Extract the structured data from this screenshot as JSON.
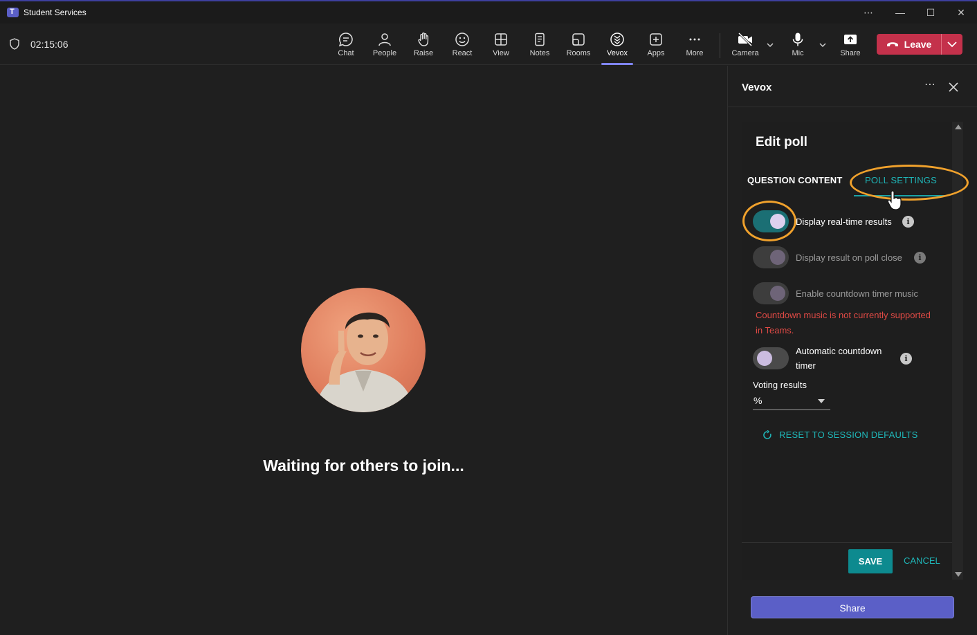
{
  "window": {
    "title": "Student Services",
    "controls": [
      "...",
      "—",
      "☐",
      "✕"
    ]
  },
  "toolbar": {
    "timer": "02:15:06",
    "buttons": [
      {
        "label": "Chat",
        "icon": "chat-icon"
      },
      {
        "label": "People",
        "icon": "people-icon"
      },
      {
        "label": "Raise",
        "icon": "raise-hand-icon"
      },
      {
        "label": "React",
        "icon": "smiley-icon"
      },
      {
        "label": "View",
        "icon": "grid-view-icon"
      },
      {
        "label": "Notes",
        "icon": "notes-icon"
      },
      {
        "label": "Rooms",
        "icon": "rooms-icon"
      },
      {
        "label": "Vevox",
        "icon": "vevox-icon",
        "active": true
      },
      {
        "label": "Apps",
        "icon": "apps-plus-icon"
      },
      {
        "label": "More",
        "icon": "more-dots-icon"
      }
    ],
    "camera_label": "Camera",
    "mic_label": "Mic",
    "share_label": "Share",
    "leave_label": "Leave"
  },
  "stage": {
    "waiting_text": "Waiting for others to join..."
  },
  "panel": {
    "title": "Vevox",
    "edit_title": "Edit poll",
    "tabs": {
      "question_content": "QUESTION CONTENT",
      "poll_settings": "POLL SETTINGS",
      "active": "poll_settings"
    },
    "options": {
      "realtime": {
        "label": "Display real-time results",
        "on": true
      },
      "on_close": {
        "label": "Display result on poll close",
        "on": false,
        "disabled": true
      },
      "timer_music": {
        "label": "Enable countdown timer music",
        "on": false,
        "disabled": true
      },
      "auto_timer_line1": "Automatic countdown",
      "auto_timer_line2": "timer"
    },
    "warning": "Countdown music is not currently supported in Teams.",
    "voting_results": {
      "label": "Voting results",
      "value": "%"
    },
    "reset_label": "RESET TO SESSION DEFAULTS",
    "save_label": "SAVE",
    "cancel_label": "CANCEL",
    "share_label": "Share"
  },
  "colors": {
    "accent_teal": "#1fb6b8",
    "teams_purple": "#5b5fc7",
    "leave_red": "#c4314b",
    "highlight": "#f0a12c",
    "warning": "#e04a45"
  }
}
